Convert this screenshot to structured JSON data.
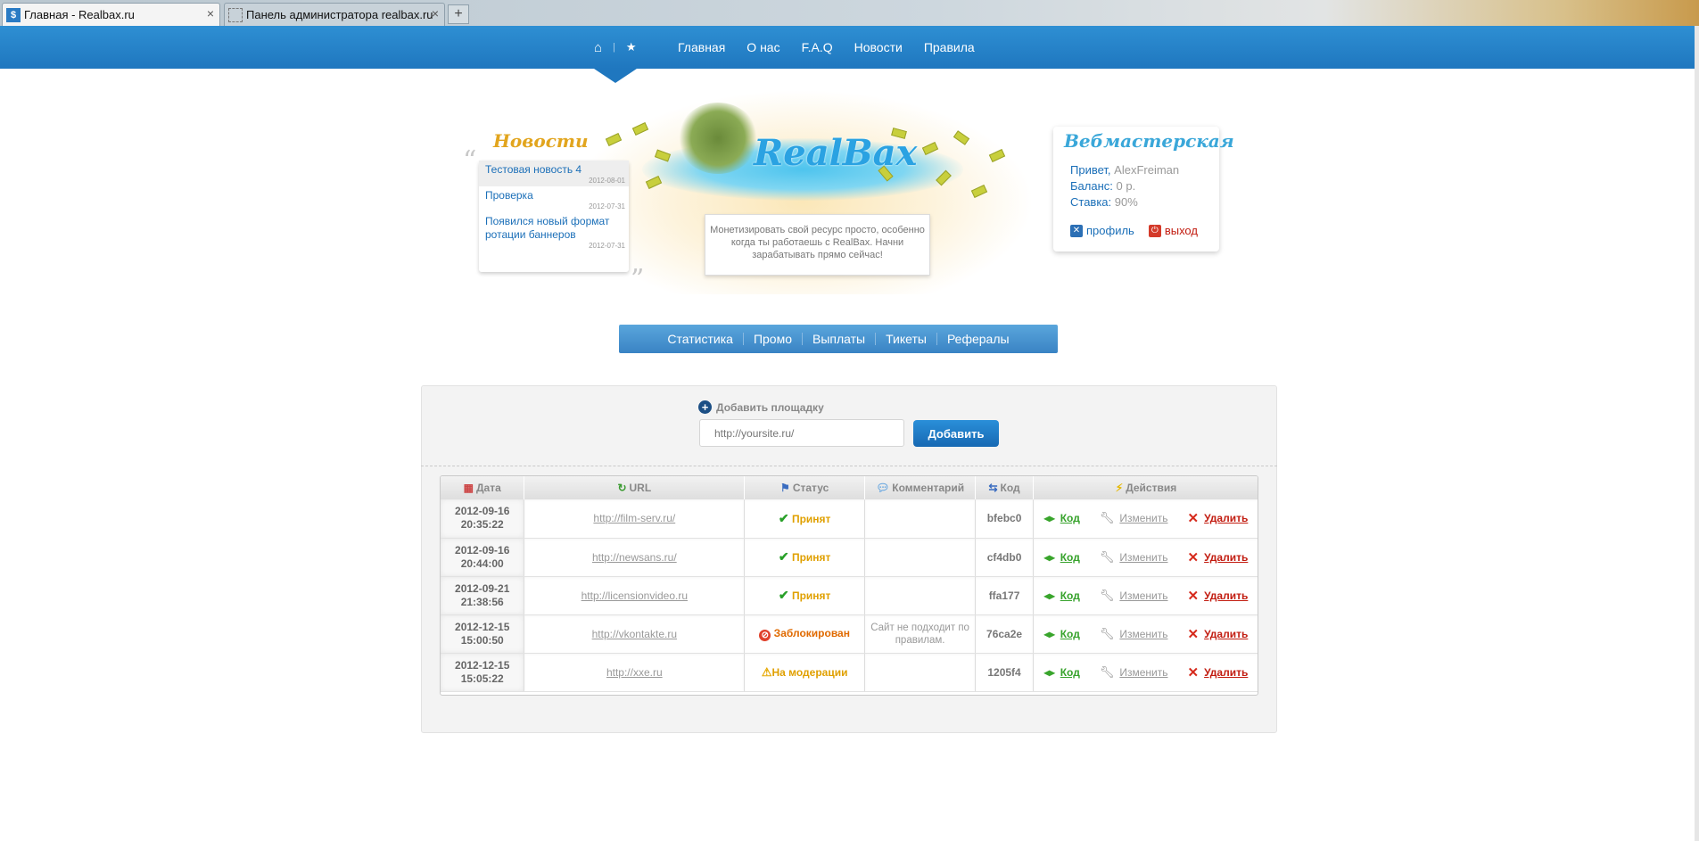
{
  "browser": {
    "tabs": [
      {
        "title": "Главная - Realbax.ru",
        "close": "×",
        "favicon": "$"
      },
      {
        "title": "Панель администратора realbax.ru",
        "close": "×"
      }
    ],
    "new_tab": "+"
  },
  "topnav": {
    "home_icon": "⌂",
    "divider": "|",
    "star_icon": "★",
    "links": [
      "Главная",
      "О нас",
      "F.A.Q",
      "Новости",
      "Правила"
    ]
  },
  "news": {
    "title": "Новости",
    "items": [
      {
        "title": "Тестовая новость 4",
        "date": "2012-08-01"
      },
      {
        "title": "Проверка",
        "date": "2012-07-31"
      },
      {
        "title": "Появился новый формат ротации баннеров",
        "date": "2012-07-31"
      }
    ]
  },
  "hero": {
    "logo": "RealBax",
    "slogan": "Монетизировать свой ресурс просто, особенно когда ты работаешь с RealBax. Начни зарабатывать прямо сейчас!"
  },
  "webmaster": {
    "title": "Вебмастерская",
    "greeting_label": "Привет,",
    "username": "AlexFreiman",
    "balance_label": "Баланс:",
    "balance_value": "0 р.",
    "rate_label": "Ставка:",
    "rate_value": "90%",
    "profile_label": "профиль",
    "logout_label": "выход"
  },
  "subnav": {
    "items": [
      "Статистика",
      "Промо",
      "Выплаты",
      "Тикеты",
      "Рефералы"
    ]
  },
  "add_site": {
    "label": "Добавить площадку",
    "placeholder": "http://yoursite.ru/",
    "button": "Добавить"
  },
  "table": {
    "headers": {
      "date": "Дата",
      "url": "URL",
      "status": "Статус",
      "comment": "Комментарий",
      "code": "Код",
      "actions": "Действия"
    },
    "action_labels": {
      "code": "Код",
      "edit": "Изменить",
      "delete": "Удалить"
    },
    "rows": [
      {
        "date": "2012-09-16",
        "time": "20:35:22",
        "url": "http://film-serv.ru/",
        "status": "Принят",
        "status_type": "accepted",
        "comment": "",
        "code": "bfebc0"
      },
      {
        "date": "2012-09-16",
        "time": "20:44:00",
        "url": "http://newsans.ru/",
        "status": "Принят",
        "status_type": "accepted",
        "comment": "",
        "code": "cf4db0"
      },
      {
        "date": "2012-09-21",
        "time": "21:38:56",
        "url": "http://licensionvideo.ru",
        "status": "Принят",
        "status_type": "accepted",
        "comment": "",
        "code": "ffa177"
      },
      {
        "date": "2012-12-15",
        "time": "15:00:50",
        "url": "http://vkontakte.ru",
        "status": "Заблокирован",
        "status_type": "blocked",
        "comment": "Сайт не подходит по правилам.",
        "code": "76ca2e"
      },
      {
        "date": "2012-12-15",
        "time": "15:05:22",
        "url": "http://xxe.ru",
        "status": "На модерации",
        "status_type": "moderation",
        "comment": "",
        "code": "1205f4"
      }
    ]
  },
  "colors": {
    "nav_blue": "#1f77bf",
    "accepted": "#e0a000",
    "blocked": "#e06a00",
    "delete": "#c21c10",
    "code_link": "#36a22b"
  }
}
